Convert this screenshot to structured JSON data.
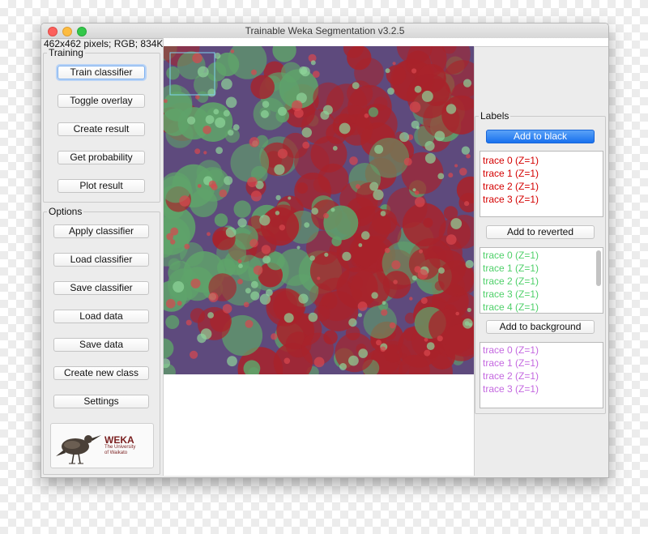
{
  "window": {
    "title": "Trainable Weka Segmentation v3.2.5",
    "info": "462x462 pixels; RGB; 834K"
  },
  "training": {
    "legend": "Training",
    "buttons": [
      "Train classifier",
      "Toggle overlay",
      "Create result",
      "Get probability",
      "Plot result"
    ]
  },
  "options": {
    "legend": "Options",
    "buttons": [
      "Apply classifier",
      "Load classifier",
      "Save classifier",
      "Load data",
      "Save data",
      "Create new class",
      "Settings"
    ]
  },
  "logo": {
    "title": "WEKA",
    "subtitle_line1": "The University",
    "subtitle_line2": "of Waikato",
    "icon": "weka-bird-icon"
  },
  "labels": {
    "legend": "Labels",
    "classes": [
      {
        "button": "Add to black",
        "color": "#d40000",
        "items": [
          "trace 0 (Z=1)",
          "trace 1 (Z=1)",
          "trace 2 (Z=1)",
          "trace 3 (Z=1)"
        ]
      },
      {
        "button": "Add to reverted",
        "color": "#4fd06a",
        "items": [
          "trace 0 (Z=1)",
          "trace 1 (Z=1)",
          "trace 2 (Z=1)",
          "trace 3 (Z=1)",
          "trace 4 (Z=1)"
        ]
      },
      {
        "button": "Add to background",
        "color": "#c468e0",
        "items": [
          "trace 0 (Z=1)",
          "trace 1 (Z=1)",
          "trace 2 (Z=1)",
          "trace 3 (Z=1)"
        ]
      }
    ]
  },
  "colors": {
    "overlay_red": "#a8232b",
    "overlay_green": "#5fa36a",
    "background_purple": "#5e4a7d",
    "primary_button": "#1a73ef"
  }
}
